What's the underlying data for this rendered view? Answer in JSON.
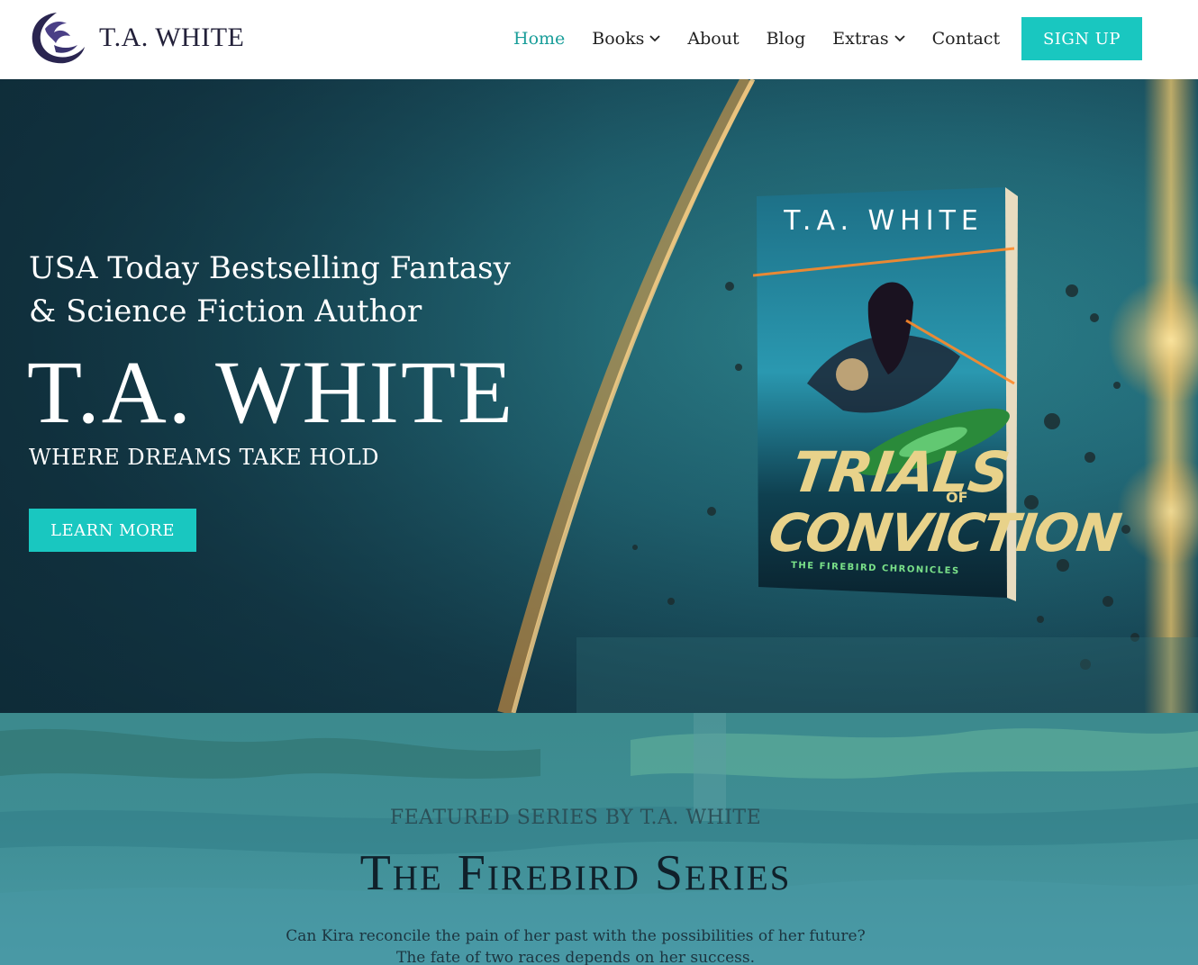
{
  "header": {
    "logo_text": "T.A. WHITE",
    "nav": [
      {
        "label": "Home",
        "active": true
      },
      {
        "label": "Books",
        "dropdown": true
      },
      {
        "label": "About"
      },
      {
        "label": "Blog"
      },
      {
        "label": "Extras",
        "dropdown": true
      },
      {
        "label": "Contact"
      }
    ],
    "signup_label": "SIGN UP"
  },
  "hero": {
    "tagline": "USA Today Bestselling Fantasy & Science Fiction Author",
    "name": "T.A. WHITE",
    "slogan": "WHERE DREAMS TAKE HOLD",
    "cta_label": "LEARN MORE",
    "book": {
      "author": "T.A. WHITE",
      "title_line1": "TRIALS",
      "title_of": "OF",
      "title_line2": "CONVICTION",
      "series": "THE FIREBIRD CHRONICLES"
    }
  },
  "featured": {
    "kicker": "FEATURED SERIES BY T.A. WHITE",
    "title": "The Firebird Series",
    "description_line1": "Can Kira reconcile the pain of her past with the possibilities of her future?",
    "description_line2": "The fate of two races depends on her success."
  },
  "colors": {
    "accent": "#19c7c0",
    "nav_active": "#1a9e9a",
    "logo": "#23213a"
  }
}
